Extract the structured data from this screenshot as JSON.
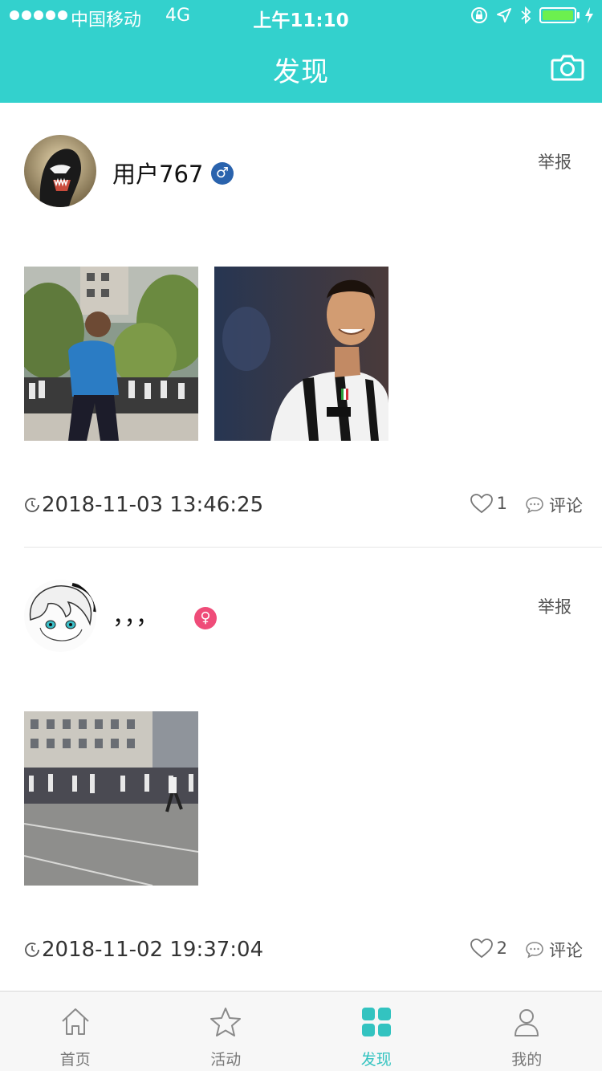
{
  "status_bar": {
    "carrier": "中国移动",
    "network": "4G",
    "time": "上午11:10",
    "icons": [
      "orientation-lock-icon",
      "location-icon",
      "bluetooth-icon",
      "battery-icon",
      "charging-icon"
    ]
  },
  "nav": {
    "title": "发现",
    "camera_icon": "camera-icon"
  },
  "posts": [
    {
      "username": "用户767",
      "gender": "male",
      "gender_symbol": "♂",
      "report_label": "举报",
      "images": [
        "photo-boy-running",
        "photo-football-player"
      ],
      "timestamp": "2018-11-03 13:46:25",
      "likes": "1",
      "comment_label": "评论"
    },
    {
      "username": "，，，",
      "gender": "female",
      "gender_symbol": "♀",
      "report_label": "举报",
      "images": [
        "photo-school-race"
      ],
      "timestamp": "2018-11-02 19:37:04",
      "likes": "2",
      "comment_label": "评论"
    }
  ],
  "tabbar": {
    "tabs": [
      {
        "label": "首页",
        "icon": "home-icon",
        "active": false
      },
      {
        "label": "活动",
        "icon": "star-icon",
        "active": false
      },
      {
        "label": "发现",
        "icon": "grid-icon",
        "active": true
      },
      {
        "label": "我的",
        "icon": "person-icon",
        "active": false
      }
    ]
  },
  "colors": {
    "accent": "#33d1cd",
    "male": "#2a63ad",
    "female": "#ef4c79"
  }
}
